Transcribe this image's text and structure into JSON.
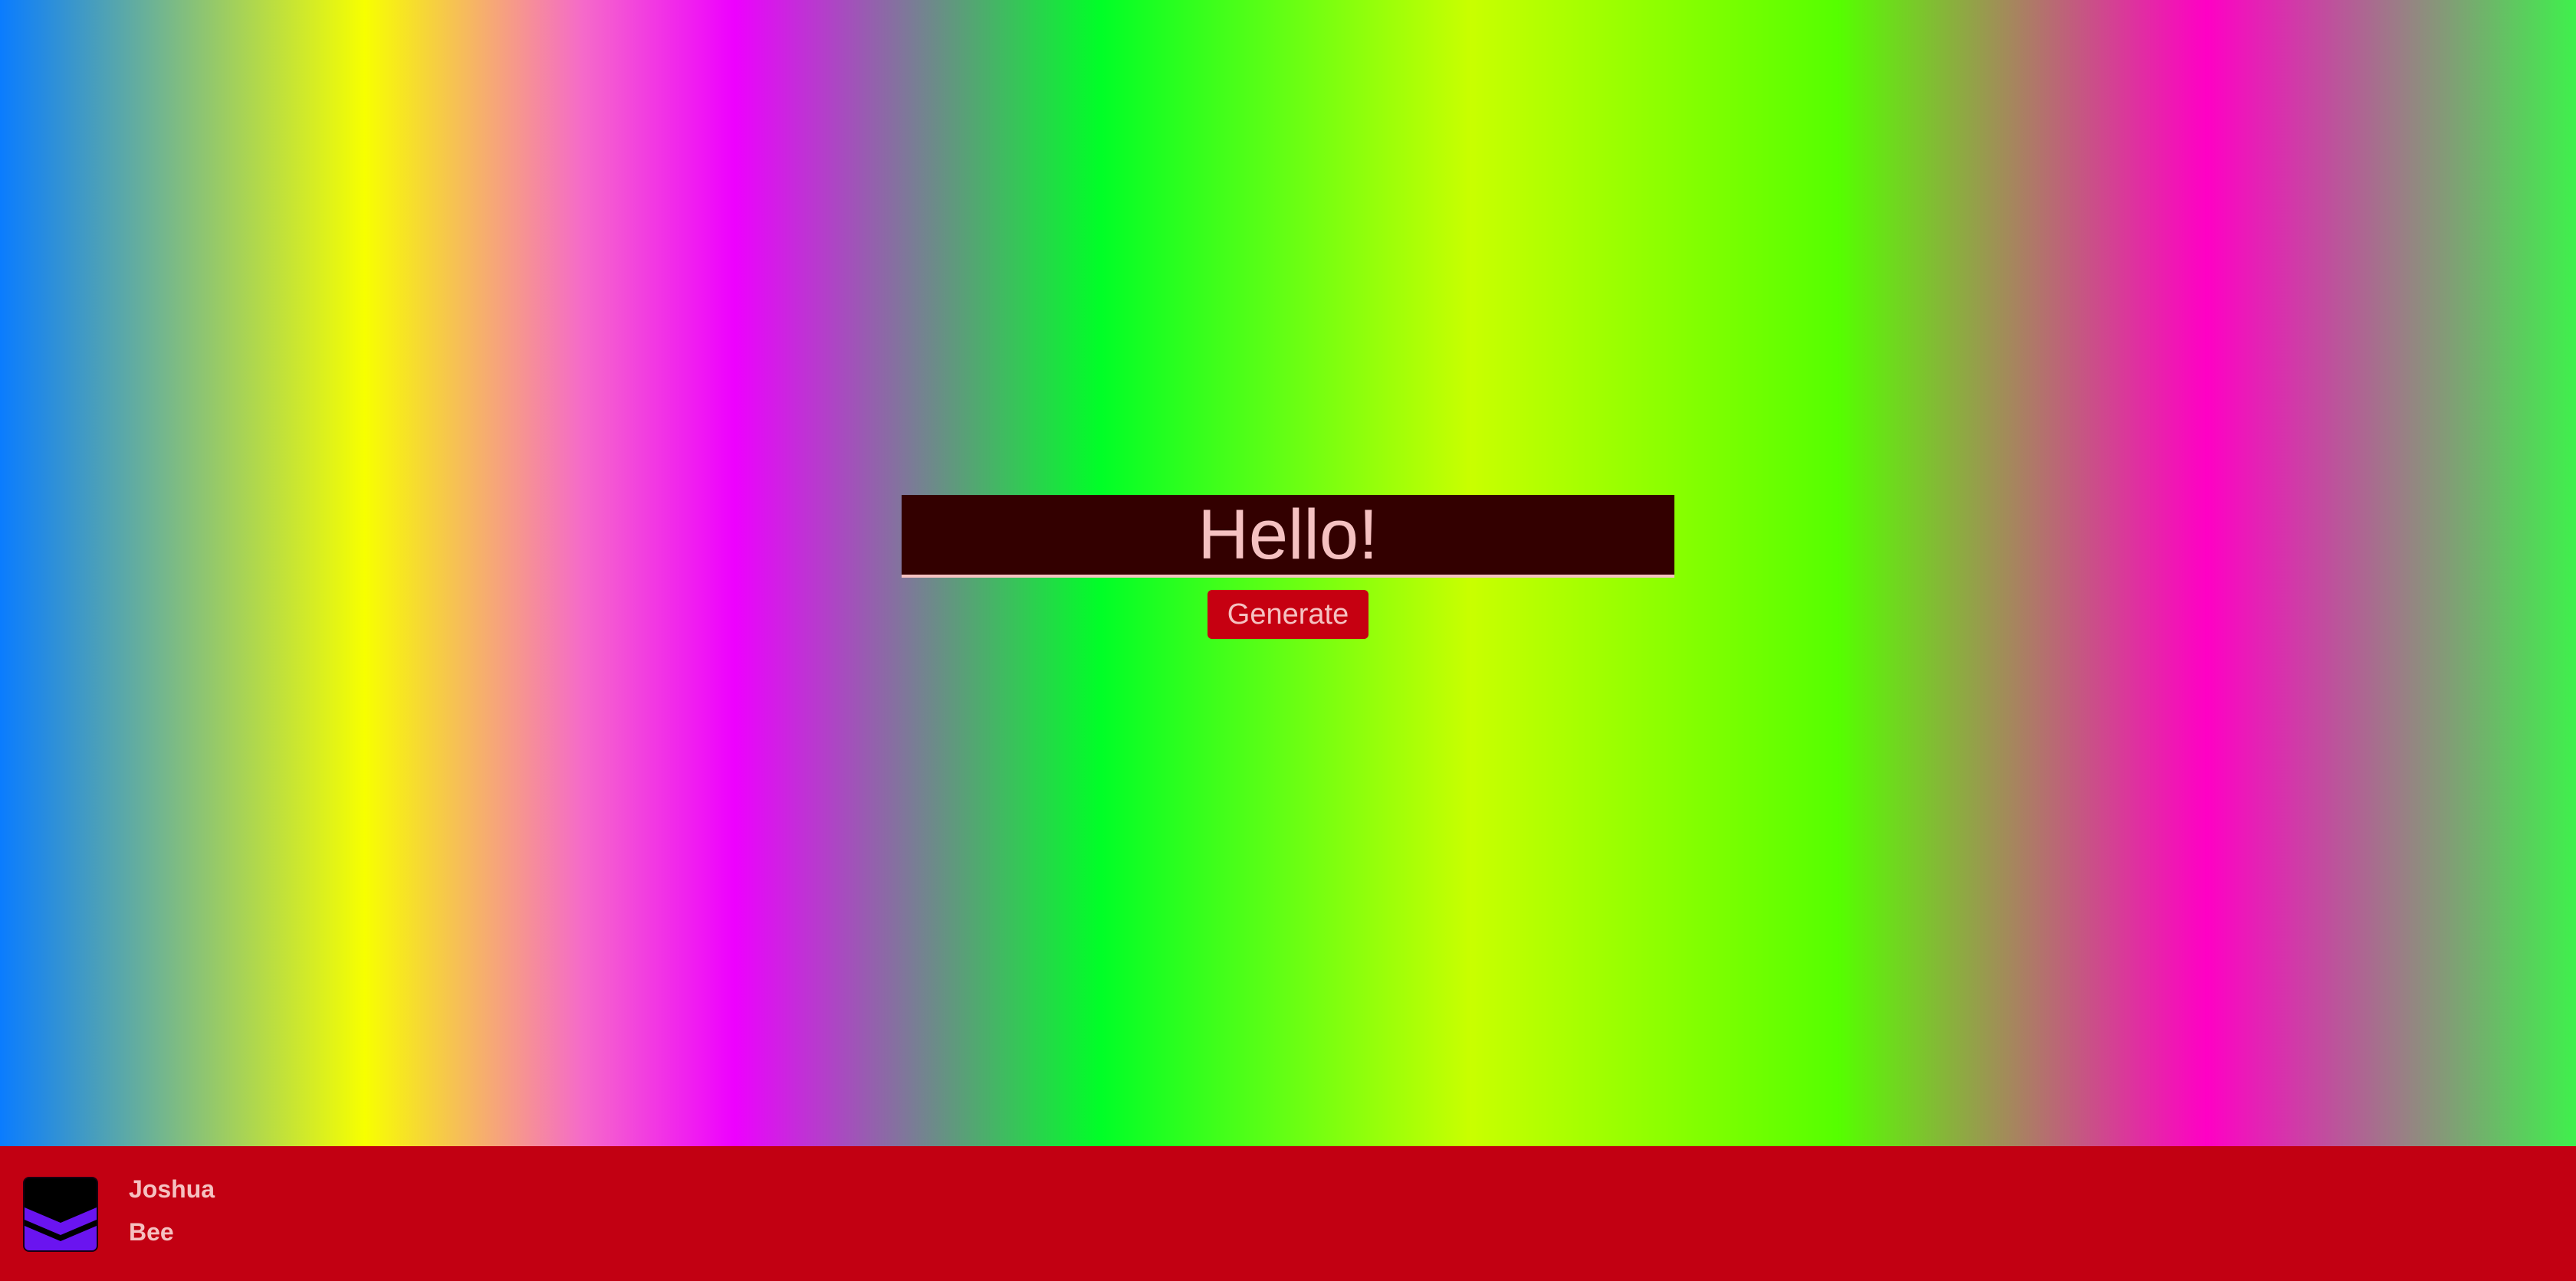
{
  "hero": {
    "input_value": "Hello!",
    "button_label": "Generate"
  },
  "footer": {
    "first_name": "Joshua",
    "last_name": "Bee"
  },
  "colors": {
    "input_bg": "#330000",
    "text_pink": "#f5c1c1",
    "accent_red": "#c60011",
    "footer_red": "#c20012",
    "avatar_purple": "#6a14f0"
  },
  "icons": {
    "avatar": "chevron-layers-icon"
  }
}
